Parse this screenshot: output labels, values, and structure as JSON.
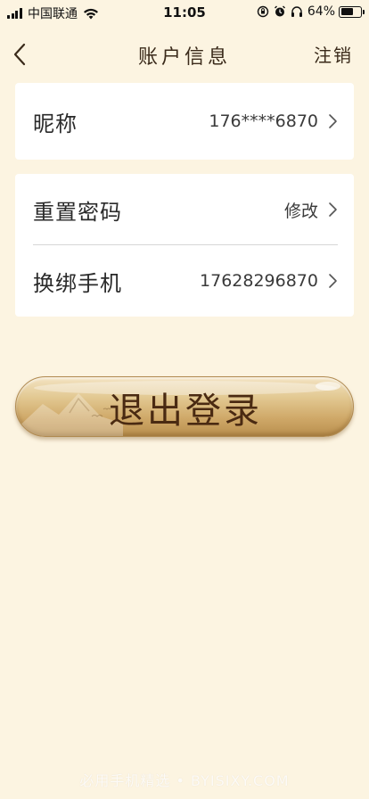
{
  "status_bar": {
    "carrier": "中国联通",
    "time": "11:05",
    "battery_percent": "64%",
    "battery_level": 0.64
  },
  "nav": {
    "title": "账户信息",
    "action_label": "注销",
    "back_icon": "chevron-left-icon"
  },
  "account": {
    "nickname": {
      "label": "昵称",
      "value": "176****6870"
    },
    "reset_password": {
      "label": "重置密码",
      "value": "修改"
    },
    "rebind_phone": {
      "label": "换绑手机",
      "value": "17628296870"
    }
  },
  "logout": {
    "label": "退出登录"
  },
  "watermark": "必用手机精选 • BYISIXY.COM",
  "colors": {
    "background": "#fcf4e1",
    "card": "#ffffff",
    "button_gold": "#d4b070",
    "button_text": "#4a2a12"
  }
}
